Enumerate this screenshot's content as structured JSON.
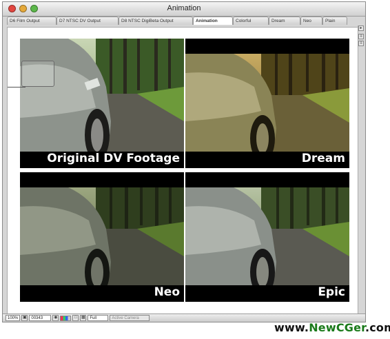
{
  "window": {
    "title": "Animation"
  },
  "tabs": [
    {
      "label": "D6 Film Output",
      "active": false
    },
    {
      "label": "D7 NTSC DV Output",
      "active": false
    },
    {
      "label": "D8 NTSC DigiBeta Output",
      "active": false
    },
    {
      "label": "Animation",
      "active": true
    },
    {
      "label": "Colorful",
      "active": false
    },
    {
      "label": "Dream",
      "active": false
    },
    {
      "label": "Neo",
      "active": false
    },
    {
      "label": "Plain",
      "active": false
    }
  ],
  "frames": [
    {
      "label": "Original DV Footage",
      "tint": "original"
    },
    {
      "label": "Dream",
      "tint": "dream"
    },
    {
      "label": "Neo",
      "tint": "neo"
    },
    {
      "label": "Epic",
      "tint": "epic"
    }
  ],
  "statusbar": {
    "zoom": "100%",
    "timecode": "00343",
    "resolution": "Full",
    "camera": "Active Camera"
  },
  "watermark": {
    "prefix": "www.",
    "brand": "NewCGer",
    "suffix": ".com"
  },
  "colors": {
    "brand_green": "#1a7a1a",
    "tab_active": "#ffffff"
  },
  "icons": [
    "close-icon",
    "minimize-icon",
    "zoom-icon",
    "camera-icon",
    "color-channels-icon",
    "arrow-right-icon"
  ]
}
